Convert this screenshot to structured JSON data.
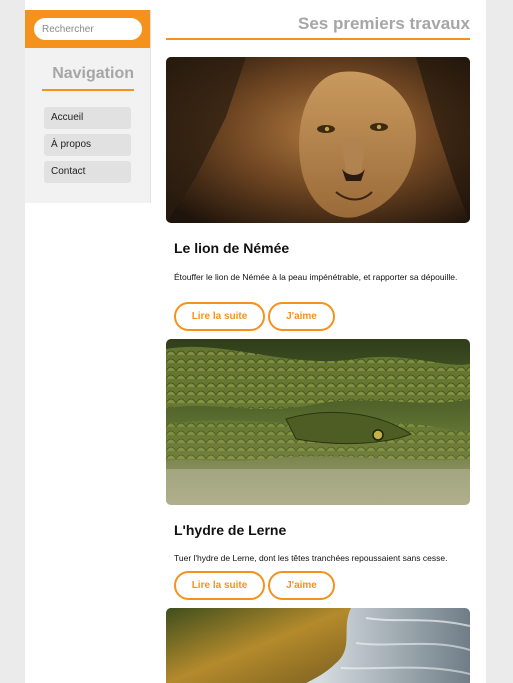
{
  "search": {
    "placeholder": "Rechercher"
  },
  "sidebar": {
    "title": "Navigation",
    "items": [
      {
        "label": "Accueil"
      },
      {
        "label": "À propos"
      },
      {
        "label": "Contact"
      }
    ]
  },
  "main": {
    "title": "Ses premiers travaux",
    "cards": [
      {
        "title": "Le lion de Némée",
        "text": "Étouffer le lion de Némée à la peau impénétrable, et rapporter sa dépouille.",
        "read_label": "Lire la suite",
        "like_label": "J'aime"
      },
      {
        "title": "L'hydre de Lerne",
        "text": "Tuer l'hydre de Lerne, dont les têtes tranchées repoussaient sans cesse.",
        "read_label": "Lire la suite",
        "like_label": "J'aime"
      },
      {
        "title": "",
        "text": "",
        "read_label": "",
        "like_label": ""
      }
    ]
  },
  "colors": {
    "accent": "#f5921e",
    "sidebar_bg": "#f2f2f2",
    "nav_item_bg": "#e1e1e1",
    "title_gray": "#a6a6a6"
  }
}
